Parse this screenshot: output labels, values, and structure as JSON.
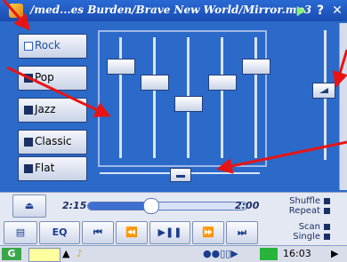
{
  "window": {
    "title": "/med...es Burden/Brave New World/Mirror.mp3",
    "play_icon": "play-icon",
    "help_label": "?",
    "close_label": "✕"
  },
  "presets": [
    {
      "label": "Rock",
      "active": true
    },
    {
      "label": "Pop",
      "active": false
    },
    {
      "label": "Jazz",
      "active": false
    },
    {
      "label": "Classic",
      "active": false
    },
    {
      "label": "Flat",
      "active": false
    }
  ],
  "equalizer": {
    "bands": [
      0.8,
      0.65,
      0.45,
      0.65,
      0.8
    ]
  },
  "balance": {
    "value": 0.5
  },
  "volume": {
    "value": 0.55
  },
  "transport": {
    "elapsed": "2:15",
    "total": "2:00",
    "progress": 0.4,
    "eq_label": "EQ",
    "modes": [
      "Shuffle",
      "Repeat",
      "Scan",
      "Single"
    ]
  },
  "taskbar": {
    "clock": "16:03",
    "keyboard_label": "▲"
  },
  "colors": {
    "panel": "#2b6ac9",
    "annotation": "#e81414"
  }
}
